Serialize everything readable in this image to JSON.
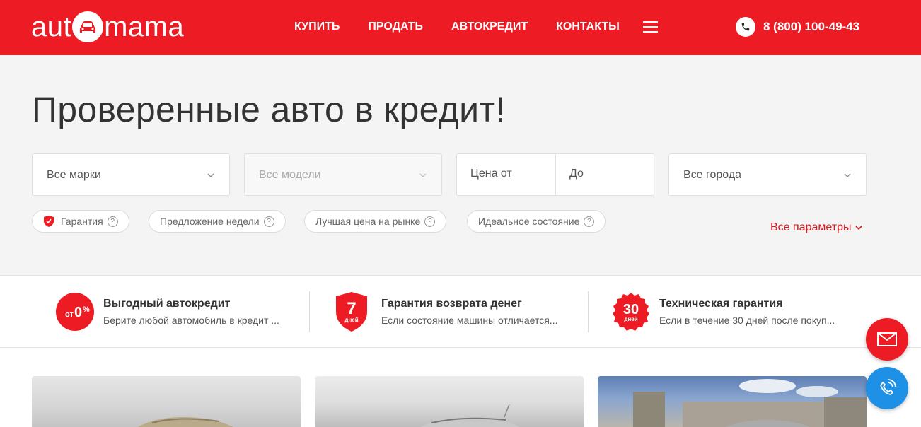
{
  "header": {
    "logo_left": "aut",
    "logo_right": "mama",
    "nav": [
      "КУПИТЬ",
      "ПРОДАТЬ",
      "АВТОКРЕДИТ",
      "КОНТАКТЫ"
    ],
    "phone": "8 (800) 100-49-43",
    "brand_color": "#ed1c24"
  },
  "hero": {
    "title": "Проверенные авто в кредит!",
    "filters": {
      "brand_placeholder": "Все марки",
      "model_placeholder": "Все модели",
      "price_from": "Цена от",
      "price_to": "До",
      "city_placeholder": "Все города"
    },
    "chips": [
      "Гарантия",
      "Предложение недели",
      "Лучшая цена на рынке",
      "Идеальное состояние"
    ],
    "all_params": "Все параметры"
  },
  "features": [
    {
      "badge_small": "от",
      "badge_big": "0",
      "badge_pct": "%",
      "title": "Выгодный автокредит",
      "sub": "Берите любой автомобиль в кредит ..."
    },
    {
      "badge_big": "7",
      "badge_small": "дней",
      "title": "Гарантия возврата денег",
      "sub": "Если состояние машины отличается..."
    },
    {
      "badge_big": "30",
      "badge_small": "дней",
      "title": "Техническая гарантия",
      "sub": "Если в течение 30 дней после покуп..."
    }
  ],
  "icons": {
    "phone": "phone-icon",
    "burger": "menu-icon",
    "mail": "mail-icon",
    "call": "call-icon"
  }
}
